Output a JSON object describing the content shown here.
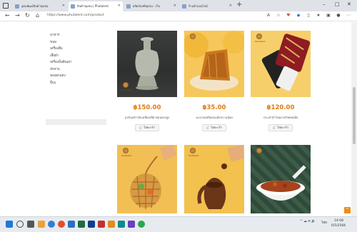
{
  "browser": {
    "tabs": [
      {
        "label": "อุดมพัฒน์สินค้าชุมชน",
        "active": false
      },
      {
        "label": "สินค้าชุมชน | Phutalent",
        "active": true
      },
      {
        "label": "ผลิตภัณฑ์ชุมชน - เว็บ",
        "active": false
      },
      {
        "label": "ร้านค้าออนไลน์",
        "active": false
      }
    ],
    "new_tab": "+",
    "url": "https://www.phutalent.com/product",
    "window_controls": [
      "–",
      "□",
      "✕"
    ]
  },
  "sidebar": {
    "items": [
      "อาหาร",
      "ขนม",
      "เครื่องดื่ม",
      "เสื้อผ้า",
      "เครื่องปั้นดินเผา",
      "จักสาน",
      "ของตกแต่ง",
      "อื่นๆ"
    ]
  },
  "products": [
    {
      "price": "฿150.00",
      "name": "แจกันเซรามิกเคลือบเขียวอ่อนทรงสูง",
      "cart_label": "ใส่ตะกร้า",
      "image": "ceramic-vase"
    },
    {
      "price": "฿35.00",
      "name": "มะม่วงแช่อิ่มอบแห้งหวานน้อย",
      "cart_label": "ใส่ตะกร้า",
      "image": "dried-mango"
    },
    {
      "price": "฿120.00",
      "name": "กระเป๋าผ้าไหมลายไทยทอมือ",
      "cart_label": "ใส่ตะกร้า",
      "image": "silk-phone-pouch"
    },
    {
      "image": "woven-basket"
    },
    {
      "image": "wooden-elephant-pot"
    },
    {
      "image": "spicy-snack-bowl"
    }
  ],
  "brand_mark": "Phutalent",
  "back_to_top": "^",
  "taskbar": {
    "tray_lang": "ไทย",
    "clock_time": "14:08",
    "clock_date": "6/5/2566"
  },
  "colors": {
    "price": "#e07a12",
    "accent": "#f08a1a",
    "yellow_bg": "#f6c75a"
  }
}
